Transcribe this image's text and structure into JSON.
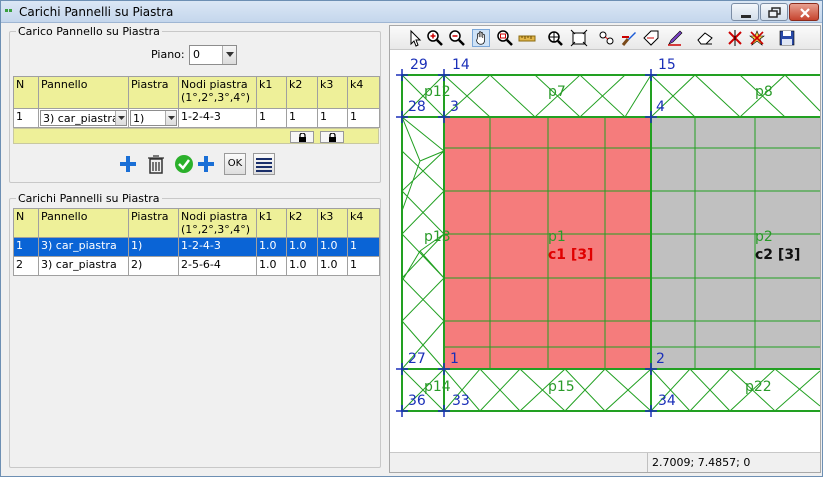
{
  "window": {
    "title": "Carichi Pannelli su Piastra"
  },
  "group1": {
    "legend": "Carico Pannello su Piastra",
    "piano_label": "Piano:",
    "piano_value": "0",
    "headers": [
      "N",
      "Pannello",
      "Piastra",
      "Nodi piastra",
      "(1°,2°,3°,4°)",
      "k1",
      "k2",
      "k3",
      "k4"
    ],
    "row": {
      "n": "1",
      "pannello": "3) car_piastra",
      "piastra": "1)",
      "nodi": "1-2-4-3",
      "k1": "1",
      "k2": "1",
      "k3": "1",
      "k4": "1"
    },
    "ok_label": "OK"
  },
  "group2": {
    "legend": "Carichi Pannelli su Piastra",
    "headers": [
      "N",
      "Pannello",
      "Piastra",
      "Nodi piastra",
      "(1°,2°,3°,4°)",
      "k1",
      "k2",
      "k3",
      "k4"
    ],
    "rows": [
      {
        "n": "1",
        "pannello": "3) car_piastra",
        "piastra": "1)",
        "nodi": "1-2-4-3",
        "k1": "1.0",
        "k2": "1.0",
        "k3": "1.0",
        "k4": "1"
      },
      {
        "n": "2",
        "pannello": "3) car_piastra",
        "piastra": "2)",
        "nodi": "2-5-6-4",
        "k1": "1.0",
        "k2": "1.0",
        "k3": "1.0",
        "k4": "1"
      }
    ]
  },
  "canvas": {
    "node_labels": [
      "29",
      "14",
      "15",
      "28",
      "3",
      "4",
      "27",
      "1",
      "2",
      "36",
      "33",
      "34"
    ],
    "panel_labels": [
      "p12",
      "p7",
      "p8",
      "p13",
      "p1",
      "p2",
      "p14",
      "p15",
      "p22"
    ],
    "load_labels": [
      "c1 [3]",
      "c2 [3]"
    ],
    "colors": {
      "panel_red": "#f57c7c",
      "panel_gray": "#c0c0c0",
      "mesh": "#22a022",
      "nodes": "#1a2fb8",
      "load_c1": "#e00000"
    }
  },
  "status": {
    "coords": "2.7009; 7.4857; 0"
  }
}
